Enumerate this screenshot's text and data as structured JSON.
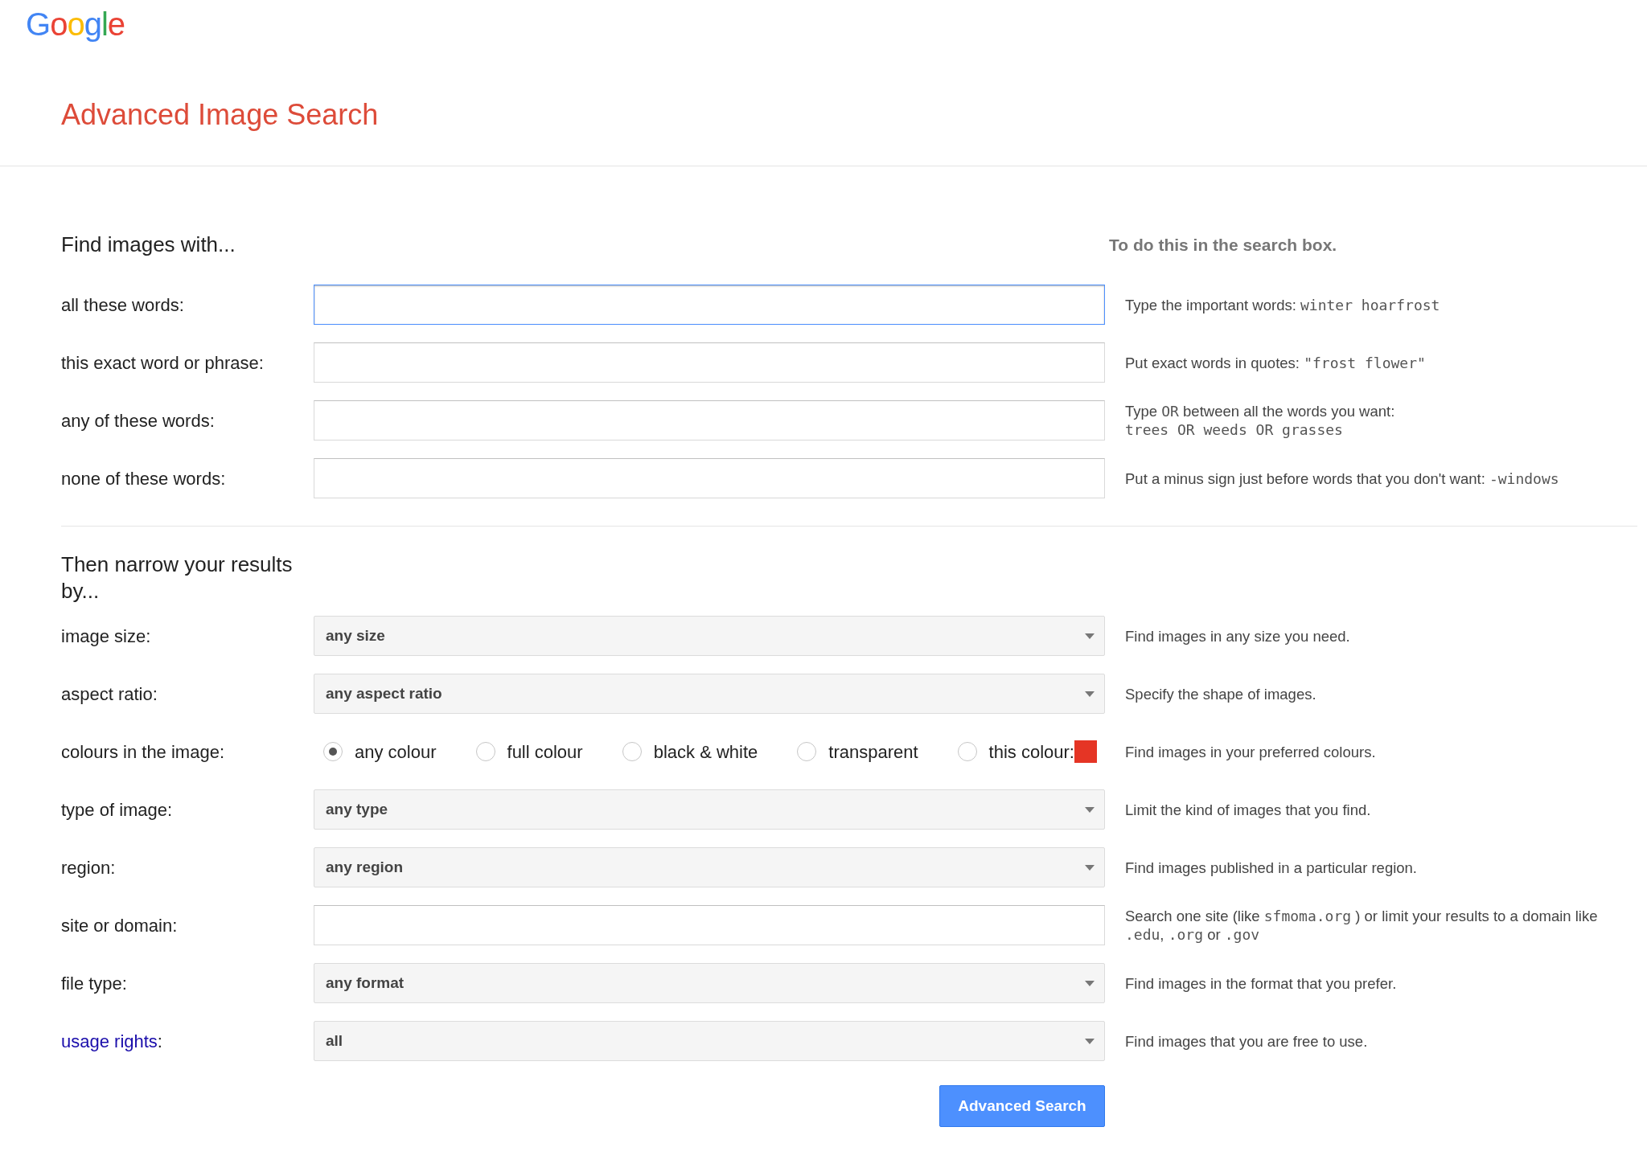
{
  "logo": "Google",
  "title": "Advanced Image Search",
  "section_1": {
    "heading": "Find images with...",
    "hint_heading": "To do this in the search box.",
    "rows": [
      {
        "kind": "text",
        "label": "all these words:",
        "value": "",
        "focused": true,
        "hint": [
          {
            "kind": "text",
            "text": "Type the important words: "
          },
          {
            "kind": "code",
            "text": "winter hoarfrost"
          }
        ]
      },
      {
        "kind": "text",
        "label": "this exact word or phrase:",
        "value": "",
        "focused": false,
        "hint": [
          {
            "kind": "text",
            "text": "Put exact words in quotes: "
          },
          {
            "kind": "code",
            "text": "\"frost flower\""
          }
        ]
      },
      {
        "kind": "text",
        "label": "any of these words:",
        "value": "",
        "focused": false,
        "hint": [
          {
            "kind": "text",
            "text": "Type "
          },
          {
            "kind": "code",
            "text": "OR"
          },
          {
            "kind": "text",
            "text": " between all the words you want:"
          },
          {
            "kind": "break"
          },
          {
            "kind": "code",
            "text": "trees OR weeds OR grasses"
          }
        ]
      },
      {
        "kind": "text",
        "label": "none of these words:",
        "value": "",
        "focused": false,
        "hint": [
          {
            "kind": "text",
            "text": "Put a minus sign just before words that you don't want: "
          },
          {
            "kind": "code",
            "text": "-windows"
          }
        ]
      }
    ]
  },
  "section_2": {
    "heading": "Then narrow your results by...",
    "rows": [
      {
        "kind": "select",
        "label": "image size:",
        "value": "any size",
        "hint": [
          {
            "kind": "text",
            "text": "Find images in any size you need."
          }
        ]
      },
      {
        "kind": "select",
        "label": "aspect ratio:",
        "value": "any aspect ratio",
        "hint": [
          {
            "kind": "text",
            "text": "Specify the shape of images."
          }
        ]
      },
      {
        "kind": "radios",
        "label": "colours in the image:",
        "options": [
          {
            "label": "any colour",
            "selected": true
          },
          {
            "label": "full colour",
            "selected": false
          },
          {
            "label": "black & white",
            "selected": false
          },
          {
            "label": "transparent",
            "selected": false
          },
          {
            "label": "this colour:",
            "selected": false,
            "color": "#e53525"
          }
        ],
        "hint": [
          {
            "kind": "text",
            "text": "Find images in your preferred colours."
          }
        ]
      },
      {
        "kind": "select",
        "label": "type of image:",
        "value": "any type",
        "hint": [
          {
            "kind": "text",
            "text": "Limit the kind of images that you find."
          }
        ]
      },
      {
        "kind": "select",
        "label": "region:",
        "value": "any region",
        "hint": [
          {
            "kind": "text",
            "text": "Find images published in a particular region."
          }
        ]
      },
      {
        "kind": "text",
        "label": "site or domain:",
        "value": "",
        "focused": false,
        "hint": [
          {
            "kind": "text",
            "text": "Search one site (like "
          },
          {
            "kind": "code",
            "text": "sfmoma.org"
          },
          {
            "kind": "text",
            "text": " ) or limit your results to a domain like "
          },
          {
            "kind": "break"
          },
          {
            "kind": "code",
            "text": ".edu"
          },
          {
            "kind": "text",
            "text": ", "
          },
          {
            "kind": "code",
            "text": ".org"
          },
          {
            "kind": "text",
            "text": " or "
          },
          {
            "kind": "code",
            "text": ".gov"
          }
        ]
      },
      {
        "kind": "select",
        "label": "file type:",
        "value": "any format",
        "hint": [
          {
            "kind": "text",
            "text": "Find images in the format that you prefer."
          }
        ]
      },
      {
        "kind": "select",
        "label": ":",
        "link_text": "usage rights",
        "value": "all",
        "hint": [
          {
            "kind": "text",
            "text": "Find images that you are free to use."
          }
        ]
      }
    ]
  },
  "submit": "Advanced Search"
}
